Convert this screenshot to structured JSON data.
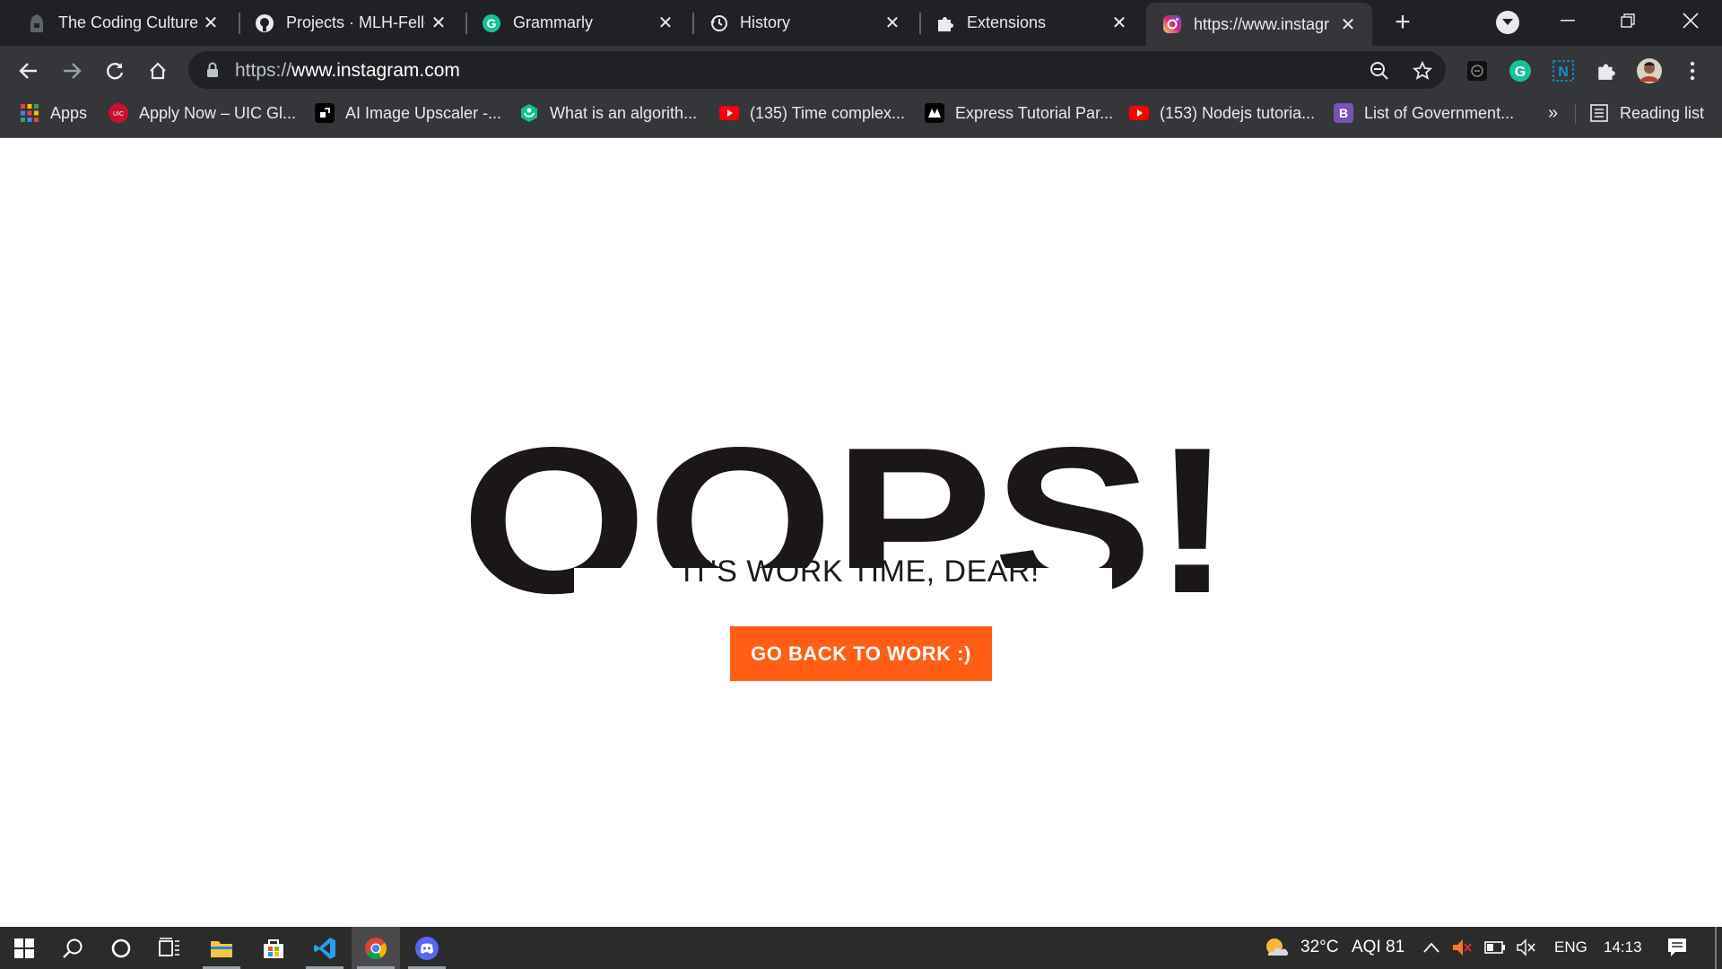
{
  "tabs": [
    {
      "title": "The Coding Culture",
      "icon": "hood-icon"
    },
    {
      "title": "Projects · MLH-Fello",
      "icon": "github-icon"
    },
    {
      "title": "Grammarly",
      "icon": "grammarly-icon"
    },
    {
      "title": "History",
      "icon": "history-icon"
    },
    {
      "title": "Extensions",
      "icon": "puzzle-icon"
    },
    {
      "title": "https://www.instagr",
      "icon": "instagram-icon",
      "active": true
    }
  ],
  "toolbar": {
    "url_scheme": "https://",
    "url_host": "www.instagram.com"
  },
  "bookmarks": [
    {
      "label": "Apps",
      "icon": "apps-grid-icon"
    },
    {
      "label": "Apply Now – UIC Gl...",
      "icon": "uic-icon"
    },
    {
      "label": "AI Image Upscaler -...",
      "icon": "upscaler-icon"
    },
    {
      "label": "What is an algorith...",
      "icon": "khan-icon"
    },
    {
      "label": "(135) Time complex...",
      "icon": "youtube-icon"
    },
    {
      "label": "Express Tutorial Par...",
      "icon": "mdn-icon"
    },
    {
      "label": "(153) Nodejs tutoria...",
      "icon": "youtube-icon"
    },
    {
      "label": "List of Government...",
      "icon": "bootstrap-icon"
    }
  ],
  "bookmarks_overflow": "»",
  "reading_list": "Reading list",
  "page": {
    "headline": "OOPS!",
    "subtitle": "IT'S WORK TIME, DEAR!",
    "button_label": "GO BACK TO WORK :)"
  },
  "taskbar": {
    "weather": "32°C",
    "aqi": "AQI 81",
    "language": "ENG",
    "time": "14:13"
  },
  "colors": {
    "accent": "#ff5e14",
    "headline": "#1c1717",
    "chrome_dark": "#202124",
    "chrome_toolbar": "#35363a"
  }
}
